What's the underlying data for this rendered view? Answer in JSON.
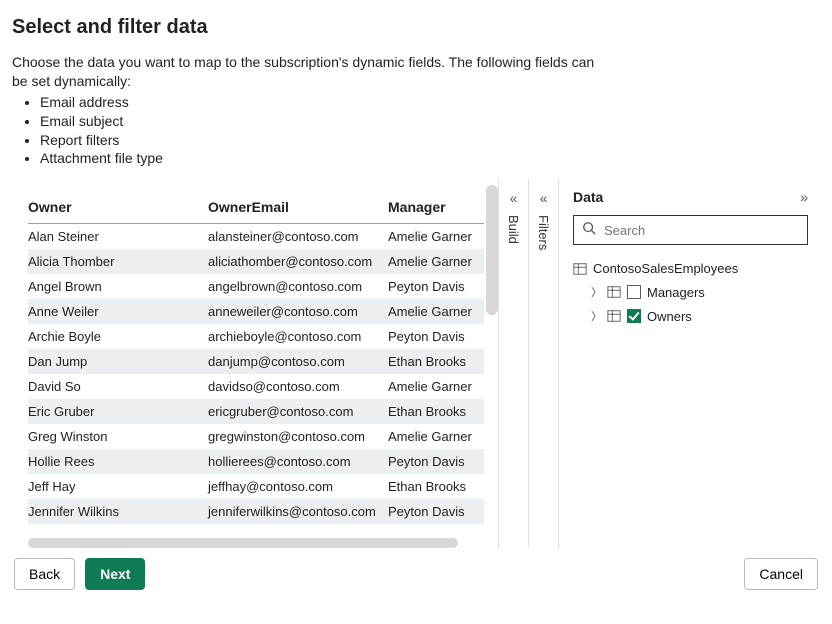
{
  "header": {
    "title": "Select and filter data",
    "intro": "Choose the data you want to map to the subscription's dynamic fields. The following fields can be set dynamically:",
    "bullets": [
      "Email address",
      "Email subject",
      "Report filters",
      "Attachment file type"
    ]
  },
  "rails": {
    "build": {
      "label": "Build"
    },
    "filters": {
      "label": "Filters"
    }
  },
  "dataPane": {
    "title": "Data",
    "searchPlaceholder": "Search",
    "tree": {
      "root": {
        "label": "ContosoSalesEmployees"
      },
      "children": [
        {
          "label": "Managers",
          "checked": false
        },
        {
          "label": "Owners",
          "checked": true
        }
      ]
    }
  },
  "table": {
    "columns": [
      "Owner",
      "OwnerEmail",
      "Manager"
    ],
    "rows": [
      [
        "Alan Steiner",
        "alansteiner@contoso.com",
        "Amelie Garner"
      ],
      [
        "Alicia Thomber",
        "aliciathomber@contoso.com",
        "Amelie Garner"
      ],
      [
        "Angel Brown",
        "angelbrown@contoso.com",
        "Peyton Davis"
      ],
      [
        "Anne Weiler",
        "anneweiler@contoso.com",
        "Amelie Garner"
      ],
      [
        "Archie Boyle",
        "archieboyle@contoso.com",
        "Peyton Davis"
      ],
      [
        "Dan Jump",
        "danjump@contoso.com",
        "Ethan Brooks"
      ],
      [
        "David So",
        "davidso@contoso.com",
        "Amelie Garner"
      ],
      [
        "Eric Gruber",
        "ericgruber@contoso.com",
        "Ethan Brooks"
      ],
      [
        "Greg Winston",
        "gregwinston@contoso.com",
        "Amelie Garner"
      ],
      [
        "Hollie Rees",
        "hollierees@contoso.com",
        "Peyton Davis"
      ],
      [
        "Jeff Hay",
        "jeffhay@contoso.com",
        "Ethan Brooks"
      ],
      [
        "Jennifer Wilkins",
        "jenniferwilkins@contoso.com",
        "Peyton Davis"
      ]
    ]
  },
  "footer": {
    "back": "Back",
    "next": "Next",
    "cancel": "Cancel"
  }
}
